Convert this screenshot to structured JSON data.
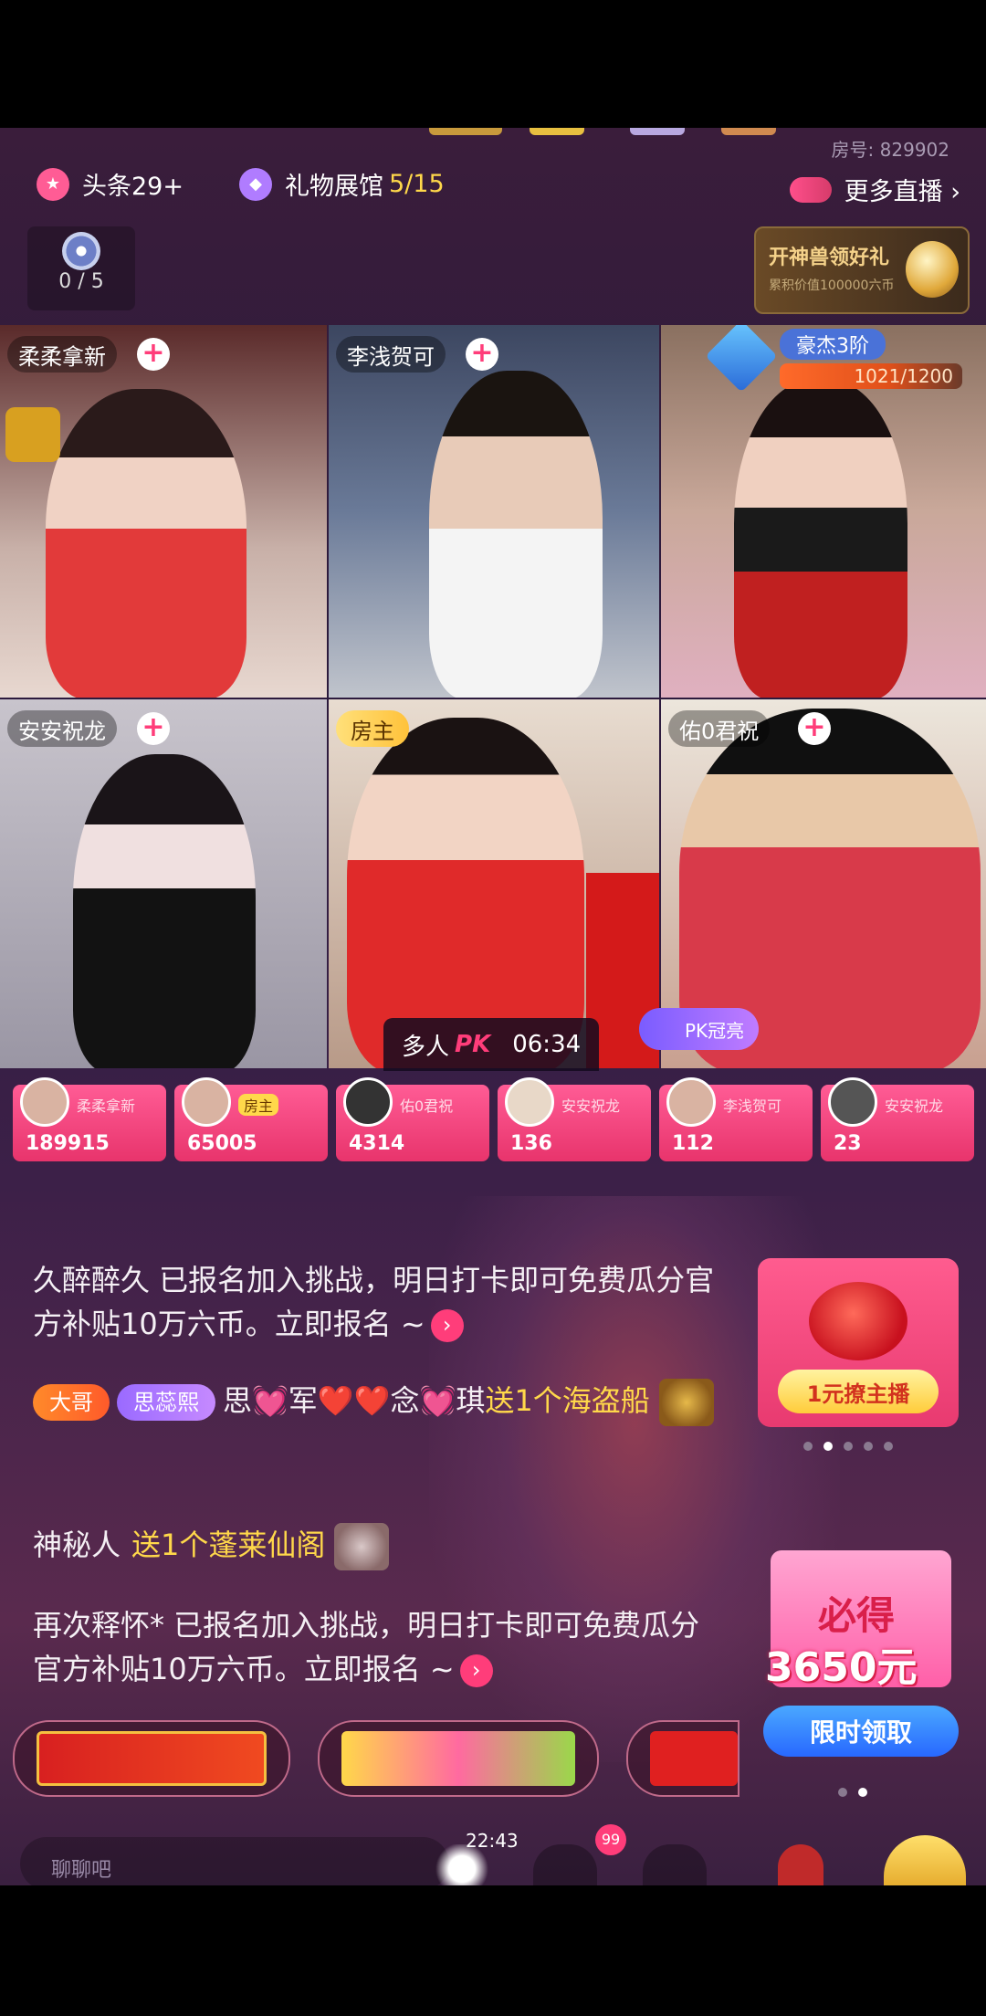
{
  "header": {
    "room_id": "房号: 829902",
    "headline_chip": "头条29+",
    "gallery_chip_label": "礼物展馆",
    "gallery_chip_count": "5/15",
    "more_live": "更多直播 ›",
    "compass_count": "0 / 5",
    "promo_title": "开神兽领好礼",
    "promo_sub": "累积价值100000六币"
  },
  "tiles": [
    {
      "name": "柔柔拿新"
    },
    {
      "name": "李浅贺可"
    },
    {
      "name": "",
      "level": "豪杰3阶",
      "progress": "1021/1200"
    },
    {
      "name": "安安祝龙"
    },
    {
      "host_tag": "房主"
    },
    {
      "name": "佑0君祝"
    }
  ],
  "pk": {
    "mode": "多人",
    "logo": "PK",
    "timer": "06:34",
    "badge": "PK冠亮"
  },
  "scores": [
    {
      "label": "柔柔拿新",
      "value": "189915"
    },
    {
      "label": "房主",
      "value": "65005"
    },
    {
      "label": "佑0君祝",
      "value": "4314"
    },
    {
      "label": "安安祝龙",
      "value": "136"
    },
    {
      "label": "李浅贺可",
      "value": "112"
    },
    {
      "label": "安安祝龙",
      "value": "23"
    }
  ],
  "chat": {
    "msg1": "久醉醉久 已报名加入挑战，明日打卡即可免费瓜分官方补贴10万六币。立即报名 ~",
    "badge1": "大哥",
    "badge2": "思蕊熙",
    "msg2_user": "思💓军❤️❤️念💓琪",
    "msg2_gift": "送1个海盗船",
    "msg3_user": "神秘人",
    "msg3_gift": "送1个蓬莱仙阁",
    "msg4": "再次释怀* 已报名加入挑战，明日打卡即可免费瓜分官方补贴10万六币。立即报名 ~",
    "go": "›"
  },
  "promo_card": {
    "button": "1元撩主播"
  },
  "benefit_card": {
    "title": "必得",
    "amount": "3650元",
    "button": "限时领取"
  },
  "bottom": {
    "input_placeholder": "聊聊吧",
    "clock": "22:43",
    "notif_count": "99"
  },
  "colors": {
    "accent": "#ff3d7a",
    "gold": "#ffd84a",
    "blue_button": "#2868ff"
  }
}
